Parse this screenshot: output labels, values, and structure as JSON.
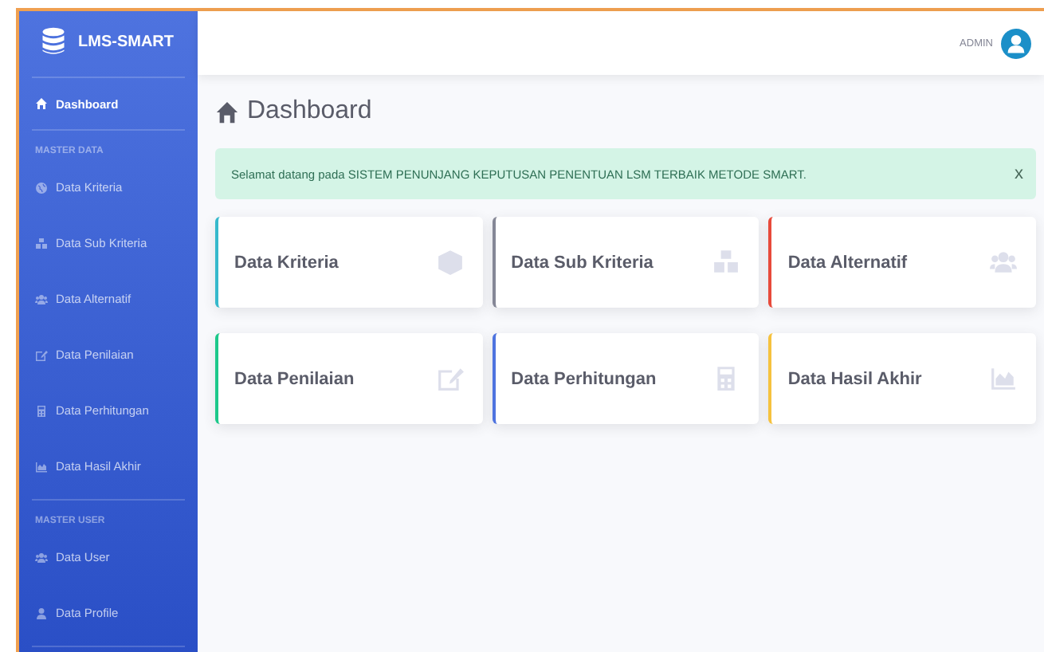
{
  "sidebar": {
    "brand": "LMS-SMART",
    "sections": [
      {
        "items": [
          {
            "label": "Dashboard",
            "selected": true
          }
        ]
      },
      {
        "heading": "MASTER DATA",
        "items": [
          {
            "label": "Data Kriteria",
            "selected": false
          },
          {
            "label": "Data Sub Kriteria",
            "selected": false
          },
          {
            "label": "Data Alternatif",
            "selected": false
          },
          {
            "label": "Data Penilaian",
            "selected": false
          },
          {
            "label": "Data Perhitungan",
            "selected": false
          },
          {
            "label": "Data Hasil Akhir",
            "selected": false
          }
        ]
      },
      {
        "heading": "MASTER USER",
        "items": [
          {
            "label": "Data User",
            "selected": false
          },
          {
            "label": "Data Profile",
            "selected": false
          }
        ]
      }
    ]
  },
  "topbar": {
    "user": "ADMIN"
  },
  "page_title": "Dashboard",
  "alert": {
    "text": "Selamat datang pada SISTEM PENUNJANG KEPUTUSAN PENENTUAN LSM TERBAIK METODE SMART.",
    "close": "x"
  },
  "cards": [
    {
      "label": "Data Kriteria",
      "color": "#36b9cc"
    },
    {
      "label": "Data Sub Kriteria",
      "color": "#858796"
    },
    {
      "label": "Data Alternatif",
      "color": "#e74a3b"
    },
    {
      "label": "Data Penilaian",
      "color": "#1cc88a"
    },
    {
      "label": "Data Perhitungan",
      "color": "#4e73df"
    },
    {
      "label": "Data Hasil Akhir",
      "color": "#f6c23e"
    }
  ]
}
